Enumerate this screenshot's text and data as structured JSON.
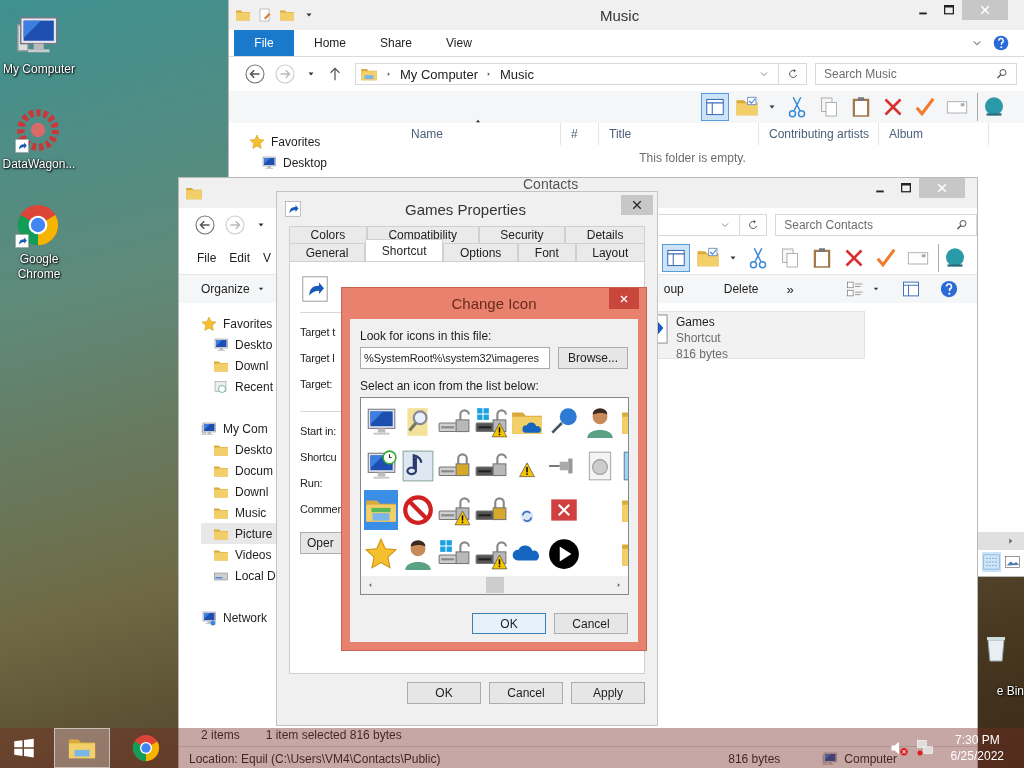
{
  "desktop": {
    "icons": [
      {
        "kind": "computer",
        "label": "My Computer",
        "shortcut": false
      },
      {
        "kind": "gear",
        "label": "DataWagon...",
        "shortcut": true
      },
      {
        "kind": "chrome",
        "label": "Google Chrome",
        "shortcut": true
      }
    ],
    "recycle_bin": {
      "label": "e Bin"
    }
  },
  "music_window": {
    "title": "Music",
    "ribbon_tabs": [
      {
        "label": "File",
        "selected": true
      },
      {
        "label": "Home",
        "selected": false
      },
      {
        "label": "Share",
        "selected": false
      },
      {
        "label": "View",
        "selected": false
      }
    ],
    "breadcrumb": [
      "My Computer",
      "Music"
    ],
    "search": {
      "placeholder": "Search Music"
    },
    "toolbar": [
      {
        "kind": "layout",
        "selected": true
      },
      {
        "kind": "folder-check",
        "selected": false
      },
      {
        "kind": "caret",
        "selected": false
      },
      {
        "kind": "scissors",
        "selected": false
      },
      {
        "kind": "copy",
        "selected": false
      },
      {
        "kind": "clipboard",
        "selected": false
      },
      {
        "kind": "x-mark",
        "selected": false
      },
      {
        "kind": "check",
        "selected": false
      },
      {
        "kind": "card",
        "selected": false
      },
      {
        "kind": "globe",
        "selected": false
      }
    ],
    "nav_items": [
      {
        "kind": "star",
        "label": "Favorites",
        "children": [
          {
            "kind": "monitor",
            "label": "Desktop"
          }
        ]
      }
    ],
    "columns": [
      "Name",
      "#",
      "Title",
      "Contributing artists",
      "Album"
    ],
    "empty_message": "This folder is empty."
  },
  "contacts_window": {
    "title": "Contacts",
    "search": {
      "placeholder": "Search Contacts"
    },
    "menu": [
      "File",
      "Edit",
      "V"
    ],
    "toolbar": [
      {
        "kind": "layout",
        "selected": true
      },
      {
        "kind": "folder-check",
        "selected": false
      },
      {
        "kind": "caret",
        "selected": false
      },
      {
        "kind": "scissors",
        "selected": false
      },
      {
        "kind": "copy",
        "selected": false
      },
      {
        "kind": "clipboard",
        "selected": false
      },
      {
        "kind": "x-mark",
        "selected": false
      },
      {
        "kind": "check",
        "selected": false
      },
      {
        "kind": "card",
        "selected": false
      },
      {
        "kind": "globe",
        "selected": false
      }
    ],
    "commands": [
      {
        "kind": "menu",
        "label": "Organize"
      },
      {
        "kind": "plain",
        "label": "oup"
      },
      {
        "kind": "plain",
        "label": "Delete"
      },
      {
        "kind": "plain",
        "label": "»"
      }
    ],
    "nav_items": [
      {
        "kind": "star",
        "label": "Favorites",
        "selected": false,
        "children": [
          {
            "kind": "monitor",
            "label": "Deskto",
            "selected": false
          },
          {
            "kind": "folder",
            "label": "Downl",
            "selected": false
          },
          {
            "kind": "recent",
            "label": "Recent",
            "selected": false
          }
        ]
      },
      {
        "kind": "computer",
        "label": "My Com",
        "selected": false,
        "children": [
          {
            "kind": "folder",
            "label": "Deskto",
            "selected": false
          },
          {
            "kind": "folder",
            "label": "Docum",
            "selected": false
          },
          {
            "kind": "folder",
            "label": "Downl",
            "selected": false
          },
          {
            "kind": "folder",
            "label": "Music",
            "selected": false
          },
          {
            "kind": "folder",
            "label": "Picture",
            "selected": true
          },
          {
            "kind": "folder",
            "label": "Videos",
            "selected": false
          },
          {
            "kind": "drive",
            "label": "Local D",
            "selected": false
          }
        ]
      },
      {
        "kind": "network",
        "label": "Network",
        "selected": false
      }
    ],
    "files": [
      {
        "name": "Games",
        "type": "Shortcut",
        "size": "816 bytes",
        "selected": true
      }
    ],
    "status_bar": {
      "count": "2 items",
      "selection": "1 item selected  816 bytes"
    },
    "details_bar": {
      "location": "Location: Equil (C:\\Users\\VM4\\Contacts\\Public)",
      "size": "816 bytes",
      "zone": "Computer"
    }
  },
  "properties_dialog": {
    "title": "Games Properties",
    "tab_rows": [
      [
        {
          "label": "Colors",
          "selected": false
        },
        {
          "label": "Compatibility",
          "selected": false
        },
        {
          "label": "Security",
          "selected": false
        },
        {
          "label": "Details",
          "selected": false
        }
      ],
      [
        {
          "label": "General",
          "selected": false
        },
        {
          "label": "Shortcut",
          "selected": true
        },
        {
          "label": "Options",
          "selected": false
        },
        {
          "label": "Font",
          "selected": false
        },
        {
          "label": "Layout",
          "selected": false
        }
      ]
    ],
    "fields_top": [
      "Target t",
      "Target l",
      "Target:"
    ],
    "fields_bottom": [
      "Start in:",
      "Shortcu",
      "Run:",
      "Commen"
    ],
    "open_button": "Oper",
    "buttons": [
      "OK",
      "Cancel",
      "Apply"
    ]
  },
  "change_icon_dialog": {
    "title": "Change Icon",
    "file_label": "Look for icons in this file:",
    "file_value": "%SystemRoot%\\system32\\imageres",
    "browse_button": "Browse...",
    "list_label": "Select an icon from the list below:",
    "icons": [
      [
        {
          "kind": "monitor",
          "selected": false
        },
        {
          "kind": "magnifier",
          "selected": false
        },
        {
          "kind": "drive-open",
          "selected": false
        },
        {
          "kind": "drive-win-warn",
          "selected": false
        },
        {
          "kind": "folder-cloud",
          "selected": false
        },
        {
          "kind": "pushpin",
          "selected": false
        },
        {
          "kind": "person",
          "selected": false
        },
        {
          "kind": "folder-edge",
          "selected": false
        }
      ],
      [
        {
          "kind": "monitor-clock",
          "selected": false
        },
        {
          "kind": "music-note",
          "selected": false
        },
        {
          "kind": "drive-lock",
          "selected": false
        },
        {
          "kind": "drive-dark-open",
          "selected": false
        },
        {
          "kind": "warning",
          "selected": false
        },
        {
          "kind": "pin-h",
          "selected": false
        },
        {
          "kind": "disc-file",
          "selected": false
        },
        {
          "kind": "doc-blue",
          "selected": false
        }
      ],
      [
        {
          "kind": "folder-window",
          "selected": true
        },
        {
          "kind": "no-sign",
          "selected": false
        },
        {
          "kind": "drive-warn",
          "selected": false
        },
        {
          "kind": "drive-dark-lock",
          "selected": false
        },
        {
          "kind": "sync",
          "selected": false
        },
        {
          "kind": "red-x",
          "selected": false
        },
        {
          "kind": "blank",
          "selected": false
        },
        {
          "kind": "folder-edge",
          "selected": false
        }
      ],
      [
        {
          "kind": "star",
          "selected": false
        },
        {
          "kind": "person",
          "selected": false
        },
        {
          "kind": "drive-win",
          "selected": false
        },
        {
          "kind": "drive-dark-warn",
          "selected": false
        },
        {
          "kind": "cloud",
          "selected": false
        },
        {
          "kind": "play",
          "selected": false
        },
        {
          "kind": "blank",
          "selected": false
        },
        {
          "kind": "folder-edge",
          "selected": false
        }
      ]
    ],
    "buttons": [
      {
        "label": "OK",
        "default": true
      },
      {
        "label": "Cancel",
        "default": false
      }
    ]
  },
  "taskbar": {
    "apps": [
      {
        "kind": "explorer",
        "active": true
      },
      {
        "kind": "chrome",
        "active": false
      }
    ],
    "volume_muted": true,
    "time": "7:30 PM",
    "date": "6/25/2022"
  }
}
